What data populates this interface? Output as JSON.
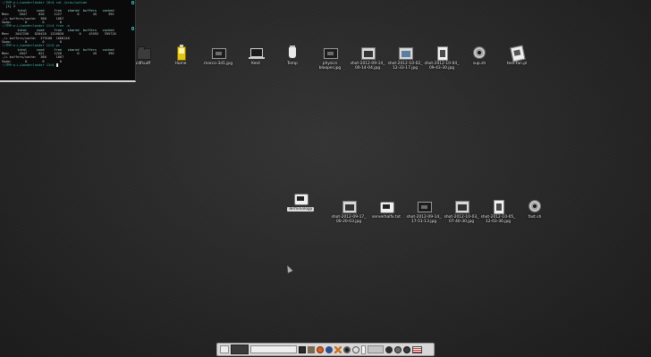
{
  "terminal": {
    "lines": [
      "~/TMP:o.L/wonderlander 10>$ cat /proc/uptime",
      "  [1] 2",
      "        total     used     free   shared  buffers   cached",
      "Mem:     2047      820     1227        0       45      395",
      "-/+ buffers/cache:  380     1667",
      "Swap:       0        0        0",
      "~/TMP:o.L/wonderlander 11>$ free -m",
      "        total     used     free   shared  buffers   cached",
      "Mem:   2047256   820428  1226828        0    45592   395728",
      "-/+ buffers/cache:  379108  1668148",
      "Swap:       0        0        0",
      "~/TMP:o.L/wonderlander 12>$ ps",
      "        total     used     free   shared  buffers   cached",
      "Mem:     2047      821     1226        0       45      396",
      "-/+ buffers/cache:  380     1667",
      "Swap:       0        0        0",
      "~/TMP:o.L/wonderlander 13>$ "
    ]
  },
  "desktop": {
    "icons": [
      {
        "label": "cdfsudf",
        "glyph": "folder-icon"
      },
      {
        "label": "Home",
        "glyph": "home-icon"
      },
      {
        "label": "marco-3d1.jpg",
        "glyph": "image-file-icon"
      },
      {
        "label": "Kent",
        "glyph": "computer-icon"
      },
      {
        "label": "Temp",
        "glyph": "trash-icon"
      },
      {
        "label": "physics\nblooper.jpg",
        "glyph": "image-file-icon"
      },
      {
        "label": "shot-2012-09-14_\n00-14-04.jpg",
        "glyph": "screenshot-icon"
      },
      {
        "label": "shot-2012-10-02_\n12-33-17.jpg",
        "glyph": "screenshot-icon"
      },
      {
        "label": "shot-2012-10-04_\n09-43-30.jpg",
        "glyph": "screenshot-icon"
      },
      {
        "label": "sup.sh",
        "glyph": "script-gear-icon"
      },
      {
        "label": "test-fan.pl",
        "glyph": "script-icon"
      },
      {
        "label": "Terminology",
        "glyph": "terminal-icon"
      },
      {
        "label": "shot-2012-09-17_\n00-20-03.jpg",
        "glyph": "screenshot-icon"
      },
      {
        "label": "serverhalfx.txt",
        "glyph": "text-file-icon"
      },
      {
        "label": "shot-2012-09-14_\n17-51-13.jpg",
        "glyph": "screenshot-icon"
      },
      {
        "label": "shot-2012-10-03_\n07-40-30.jpg",
        "glyph": "screenshot-icon"
      },
      {
        "label": "shot-2012-10-05_\n12-03-36.jpg",
        "glyph": "screenshot-icon"
      },
      {
        "label": "fast.sh",
        "glyph": "script-gear-icon"
      }
    ]
  },
  "taskbar": {
    "items": [
      "start-button",
      "window-button",
      "app-icon",
      "file-manager-icon",
      "browser-icon",
      "settings-icon",
      "close-icon",
      "gear-icon",
      "media-icon",
      "battery-icon",
      "volume-icon",
      "network-icon",
      "clock-icon",
      "flag-icon"
    ]
  },
  "colors": {
    "background": "#2b2b2b",
    "prompt": "#3dbbb0",
    "taskbar": "#d7d7d7"
  }
}
